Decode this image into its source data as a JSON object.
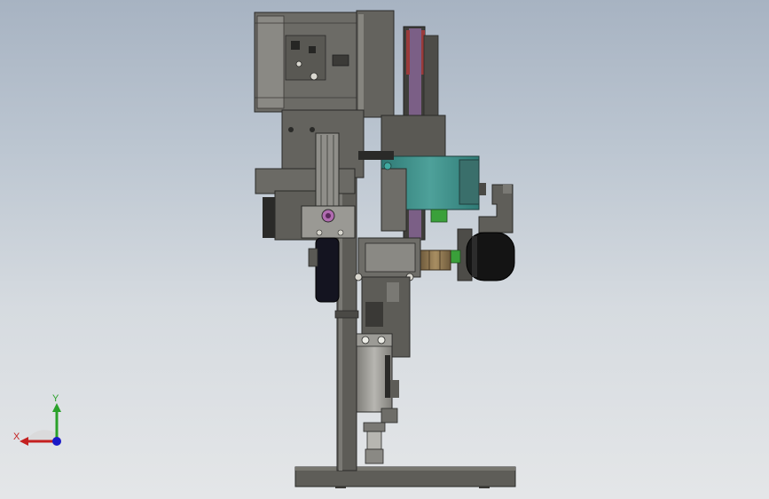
{
  "viewport": {
    "background_top": "#a7b3c2",
    "background_bottom": "#e4e6e8"
  },
  "triad": {
    "x_label": "X",
    "y_label": "Y",
    "x_color": "#c42020",
    "y_color": "#2aa12a",
    "z_color": "#1a1ac8"
  },
  "model": {
    "frame_color": "#5b5a55",
    "body_color": "#6e6d68",
    "highlight_color": "#8a8984",
    "accent_teal": "#3f8f8a",
    "accent_purple": "#7b5f86",
    "accent_black": "#141414",
    "accent_bronze": "#8a7350"
  }
}
